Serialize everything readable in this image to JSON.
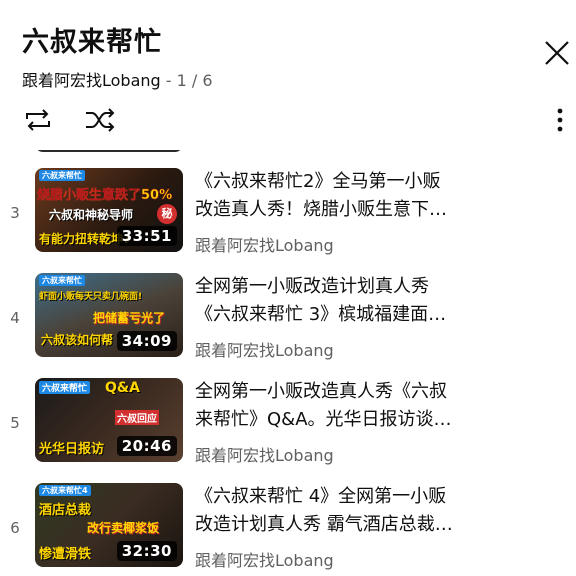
{
  "header": {
    "title": "六叔来帮忙",
    "channel": "跟着阿宏找Lobang",
    "separator": " - ",
    "position": "1 / 6"
  },
  "controls": {
    "loop_icon": "loop-icon",
    "shuffle_icon": "shuffle-icon",
    "more_icon": "more-vertical-icon",
    "close_icon": "close-icon"
  },
  "items": [
    {
      "index": "3",
      "title_line1": "《六叔来帮忙2》全马第一小贩",
      "title_line2": "改造真人秀！烧腊小贩生意下…",
      "channel": "跟着阿宏找Lobang",
      "duration": "33:51",
      "thumb_tag": "六叔来帮忙",
      "thumb_line1": "烧腊小贩生意跌了50%",
      "thumb_line2": "六叔和神秘导师",
      "thumb_line3": "有能力扭转乾坤?",
      "thumb_badge": "秘"
    },
    {
      "index": "4",
      "title_line1": "全网第一小贩改造计划真人秀",
      "title_line2": "《六叔来帮忙 3》槟城福建面…",
      "channel": "跟着阿宏找Lobang",
      "duration": "34:09",
      "thumb_tag": "六叔来帮忙",
      "thumb_line1": "虾面小贩每天只卖几碗面!",
      "thumb_line2": "把储蓄亏光了",
      "thumb_line3": "六叔该如何帮"
    },
    {
      "index": "5",
      "title_line1": "全网第一小贩改造真人秀《六叔",
      "title_line2": "来帮忙》Q&A。光华日报访谈…",
      "channel": "跟着阿宏找Lobang",
      "duration": "20:46",
      "thumb_tag": "六叔来帮忙",
      "thumb_line1": "Q&A",
      "thumb_line2": "六叔回应",
      "thumb_line3": "光华日报访"
    },
    {
      "index": "6",
      "title_line1": "《六叔来帮忙 4》全网第一小贩",
      "title_line2": "改造计划真人秀 霸气酒店总裁…",
      "channel": "跟着阿宏找Lobang",
      "duration": "32:30",
      "thumb_tag": "六叔来帮忙4",
      "thumb_line1": "酒店总裁",
      "thumb_line2": "改行卖椰浆饭",
      "thumb_line3": "惨遭滑铁"
    }
  ],
  "colors": {
    "accent_yellow": "#ffd600",
    "badge_red": "#d32f2f",
    "text_secondary": "#606060"
  }
}
